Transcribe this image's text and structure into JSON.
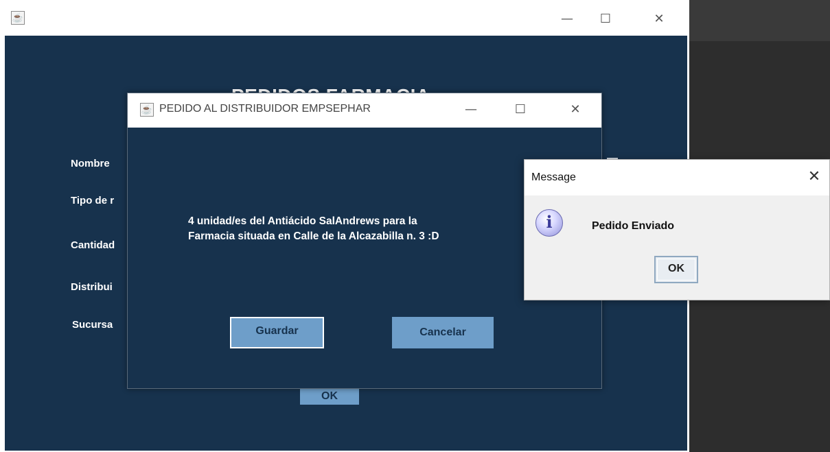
{
  "main_window": {
    "title": "PEDIDOS FARMACIA",
    "labels": {
      "nombre": "Nombre",
      "tipo": "Tipo de r",
      "cantidad": "Cantidad",
      "distribuidor": "Distribui",
      "sucursal": "Sucursa"
    },
    "ok_label": "OK",
    "controls": {
      "minimize": "—",
      "maximize": "☐",
      "close": "✕"
    }
  },
  "pedido_dialog": {
    "title": "PEDIDO AL DISTRIBUIDOR EMPSEPHAR",
    "message_line1": "4 unidad/es del Antiácido SalAndrews para la",
    "message_line2": "Farmacia situada en Calle de la Alcazabilla n. 3 :D",
    "guardar_label": "Guardar",
    "cancelar_label": "Cancelar",
    "controls": {
      "minimize": "—",
      "maximize": "☐",
      "close": "✕"
    }
  },
  "message_dialog": {
    "title": "Message",
    "text": "Pedido Enviado",
    "ok_label": "OK",
    "icon": "i",
    "close": "✕"
  },
  "colors": {
    "panel_bg": "#17324d",
    "button_bg": "#6e9ec9",
    "dialog_bg": "#f0f0f0"
  },
  "icons": [
    "java-icon",
    "info-icon",
    "minimize-icon",
    "maximize-icon",
    "close-icon"
  ]
}
